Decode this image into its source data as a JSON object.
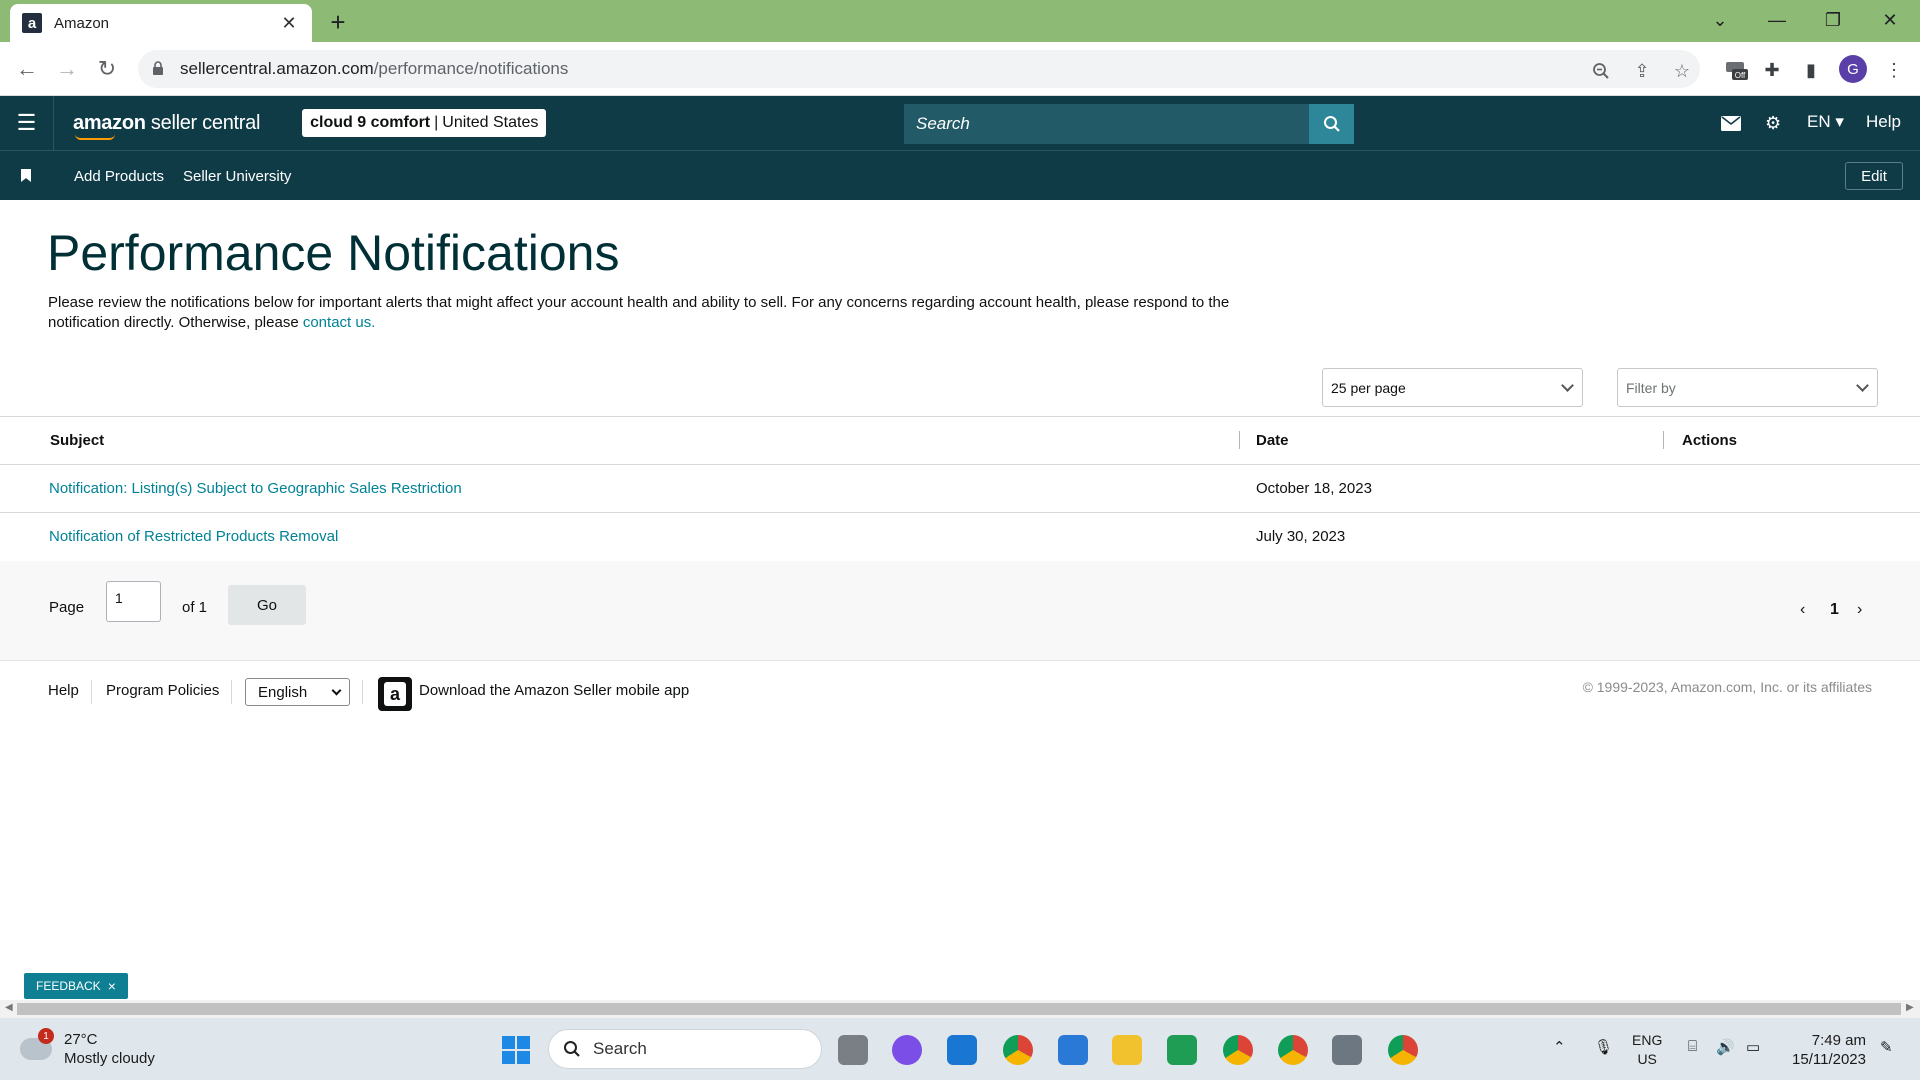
{
  "browser": {
    "tab_title": "Amazon",
    "tab_favicon": "a",
    "url_host": "sellercentral.amazon.com",
    "url_path": "/performance/notifications",
    "profile_initial": "G"
  },
  "header": {
    "logo_amazon": "amazon",
    "logo_rest": " seller central",
    "store_name": "cloud 9 comfort",
    "store_separator": "|",
    "store_region": "United States",
    "search_placeholder": "Search",
    "lang": "EN",
    "help": "Help"
  },
  "subnav": {
    "items": [
      "Add Products",
      "Seller University"
    ],
    "edit": "Edit"
  },
  "main": {
    "title": "Performance Notifications",
    "description": "Please review the notifications below for important alerts that might affect your account health and ability to sell. For any concerns regarding account health, please respond to the notification directly. Otherwise, please ",
    "contact_link": "contact us.",
    "per_page": "25 per page",
    "filter_placeholder": "Filter by",
    "columns": {
      "subject": "Subject",
      "date": "Date",
      "actions": "Actions"
    },
    "rows": [
      {
        "subject": "Notification: Listing(s) Subject to Geographic Sales Restriction",
        "date": "October 18, 2023"
      },
      {
        "subject": "Notification of Restricted Products Removal",
        "date": "July 30, 2023"
      }
    ]
  },
  "pager": {
    "page_label": "Page",
    "page_value": "1",
    "of_label": "of 1",
    "go": "Go",
    "current": "1"
  },
  "footer": {
    "help": "Help",
    "policies": "Program Policies",
    "language": "English",
    "app_text": "Download the Amazon Seller mobile app",
    "app_icon_letter": "a",
    "copyright": "© 1999-2023, Amazon.com, Inc. or its affiliates"
  },
  "feedback": {
    "label": "FEEDBACK",
    "close": "×"
  },
  "taskbar": {
    "weather_badge": "1",
    "temperature": "27°C",
    "condition": "Mostly cloudy",
    "search": "Search",
    "lang_top": "ENG",
    "lang_bottom": "US",
    "time": "7:49 am",
    "date": "15/11/2023"
  },
  "colors": {
    "header_bg": "#0f3b47",
    "link": "#008296",
    "tabbar_bg": "#8dbb76",
    "search_btn": "#2e8799"
  }
}
